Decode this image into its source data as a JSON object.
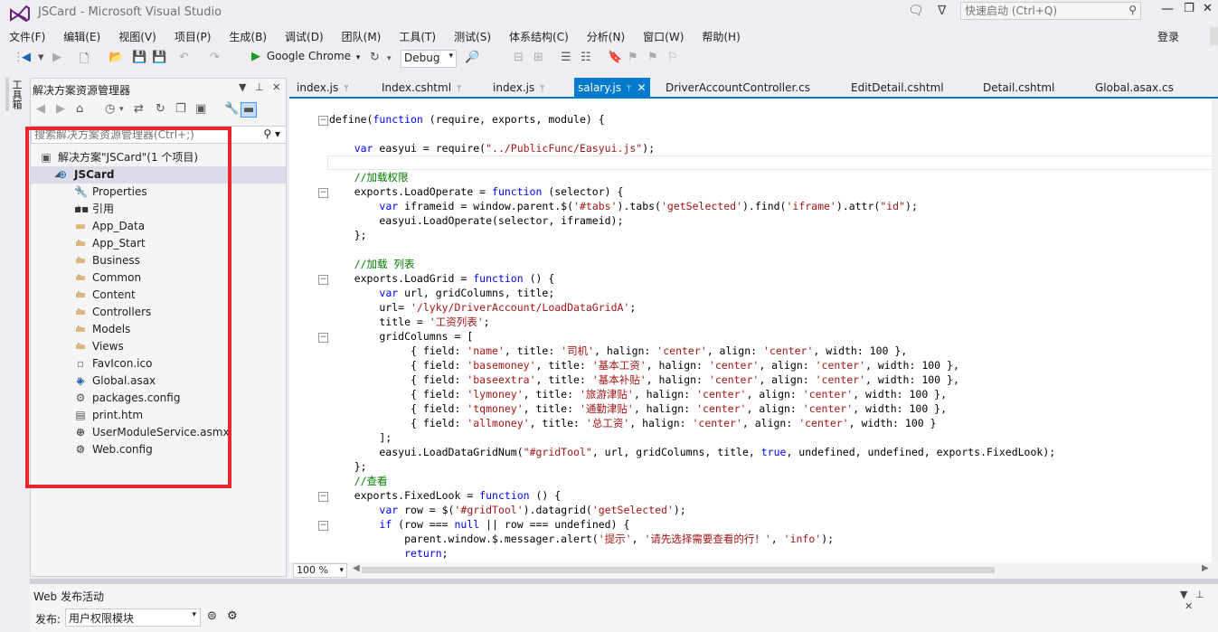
{
  "window": {
    "title": "JSCard - Microsoft Visual Studio",
    "quick_launch_placeholder": "快速启动 (Ctrl+Q)",
    "sign_in": "登录"
  },
  "menu": [
    "文件(F)",
    "编辑(E)",
    "视图(V)",
    "项目(P)",
    "生成(B)",
    "调试(D)",
    "团队(M)",
    "工具(T)",
    "测试(S)",
    "体系结构(C)",
    "分析(N)",
    "窗口(W)",
    "帮助(H)"
  ],
  "toolbar": {
    "browser": "Google Chrome",
    "config": "Debug"
  },
  "toolbox": {
    "label": "工具箱"
  },
  "solution_explorer": {
    "title": "解决方案资源管理器",
    "search_placeholder": "搜索解决方案资源管理器(Ctrl+;)",
    "tree": [
      {
        "label": "解决方案\"JSCard\"(1 个项目)",
        "icon": "solution-icon",
        "depth": 0,
        "expander": "none"
      },
      {
        "label": "JSCard",
        "icon": "web-project-icon",
        "depth": 1,
        "expander": "expanded",
        "selected": true,
        "bold": true
      },
      {
        "label": "Properties",
        "icon": "wrench-icon",
        "depth": 2,
        "expander": "collapsed"
      },
      {
        "label": "引用",
        "icon": "references-icon",
        "depth": 2,
        "expander": "collapsed"
      },
      {
        "label": "App_Data",
        "icon": "folder-icon",
        "depth": 2,
        "expander": "none"
      },
      {
        "label": "App_Start",
        "icon": "folder-icon",
        "depth": 2,
        "expander": "collapsed"
      },
      {
        "label": "Business",
        "icon": "folder-icon",
        "depth": 2,
        "expander": "collapsed"
      },
      {
        "label": "Common",
        "icon": "folder-icon",
        "depth": 2,
        "expander": "collapsed"
      },
      {
        "label": "Content",
        "icon": "folder-icon",
        "depth": 2,
        "expander": "collapsed"
      },
      {
        "label": "Controllers",
        "icon": "folder-icon",
        "depth": 2,
        "expander": "collapsed"
      },
      {
        "label": "Models",
        "icon": "folder-icon",
        "depth": 2,
        "expander": "collapsed"
      },
      {
        "label": "Views",
        "icon": "folder-icon",
        "depth": 2,
        "expander": "collapsed"
      },
      {
        "label": "FavIcon.ico",
        "icon": "image-file-icon",
        "depth": 2,
        "expander": "none"
      },
      {
        "label": "Global.asax",
        "icon": "asax-file-icon",
        "depth": 2,
        "expander": "collapsed"
      },
      {
        "label": "packages.config",
        "icon": "config-file-icon",
        "depth": 2,
        "expander": "none"
      },
      {
        "label": "print.htm",
        "icon": "html-file-icon",
        "depth": 2,
        "expander": "none"
      },
      {
        "label": "UserModuleService.asmx",
        "icon": "web-service-icon",
        "depth": 2,
        "expander": "collapsed"
      },
      {
        "label": "Web.config",
        "icon": "config-file-icon",
        "depth": 2,
        "expander": "collapsed"
      }
    ]
  },
  "tabs": [
    {
      "label": "index.js",
      "pinned": true
    },
    {
      "label": "Index.cshtml",
      "pinned": true
    },
    {
      "label": "index.js",
      "pinned": true
    },
    {
      "label": "salary.js",
      "pinned": true,
      "active": true
    },
    {
      "label": "DriverAccountController.cs"
    },
    {
      "label": "EditDetail.cshtml"
    },
    {
      "label": "Detail.cshtml"
    },
    {
      "label": "Global.asax.cs"
    }
  ],
  "editor": {
    "zoom": "100 %",
    "lines": [
      [
        [
          "define(",
          ""
        ],
        [
          "function",
          "kw"
        ],
        [
          " (require, exports, module) {",
          ""
        ]
      ],
      [
        [
          "",
          ""
        ]
      ],
      [
        [
          "    ",
          ""
        ],
        [
          "var",
          "kw"
        ],
        [
          " easyui = require(",
          ""
        ],
        [
          "\"../PublicFunc/Easyui.js\"",
          "str"
        ],
        [
          ");",
          ""
        ]
      ],
      [
        [
          "",
          ""
        ]
      ],
      [
        [
          "    ",
          ""
        ],
        [
          "//加载权限",
          "cm"
        ]
      ],
      [
        [
          "    exports.LoadOperate = ",
          ""
        ],
        [
          "function",
          "kw"
        ],
        [
          " (selector) {",
          ""
        ]
      ],
      [
        [
          "        ",
          ""
        ],
        [
          "var",
          "kw"
        ],
        [
          " iframeid = window.parent.$(",
          ""
        ],
        [
          "'#tabs'",
          "str"
        ],
        [
          ").tabs(",
          ""
        ],
        [
          "'getSelected'",
          "str"
        ],
        [
          ").find(",
          ""
        ],
        [
          "'iframe'",
          "str"
        ],
        [
          ").attr(",
          ""
        ],
        [
          "\"id\"",
          "str"
        ],
        [
          ");",
          ""
        ]
      ],
      [
        [
          "        easyui.LoadOperate(selector, iframeid);",
          ""
        ]
      ],
      [
        [
          "    };",
          ""
        ]
      ],
      [
        [
          "",
          ""
        ]
      ],
      [
        [
          "    ",
          ""
        ],
        [
          "//加载 列表",
          "cm"
        ]
      ],
      [
        [
          "    exports.LoadGrid = ",
          ""
        ],
        [
          "function",
          "kw"
        ],
        [
          " () {",
          ""
        ]
      ],
      [
        [
          "        ",
          ""
        ],
        [
          "var",
          "kw"
        ],
        [
          " url, gridColumns, title;",
          ""
        ]
      ],
      [
        [
          "        url= ",
          ""
        ],
        [
          "'/lyky/DriverAccount/LoadDataGridA'",
          "str"
        ],
        [
          ";",
          ""
        ]
      ],
      [
        [
          "        title = ",
          ""
        ],
        [
          "'工资列表'",
          "str"
        ],
        [
          ";",
          ""
        ]
      ],
      [
        [
          "        gridColumns = [",
          ""
        ]
      ],
      [
        [
          "             { field: ",
          ""
        ],
        [
          "'name'",
          "str"
        ],
        [
          ", title: ",
          ""
        ],
        [
          "'司机'",
          "str"
        ],
        [
          ", halign: ",
          ""
        ],
        [
          "'center'",
          "str"
        ],
        [
          ", align: ",
          ""
        ],
        [
          "'center'",
          "str"
        ],
        [
          ", width: 100 },",
          ""
        ]
      ],
      [
        [
          "             { field: ",
          ""
        ],
        [
          "'basemoney'",
          "str"
        ],
        [
          ", title: ",
          ""
        ],
        [
          "'基本工资'",
          "str"
        ],
        [
          ", halign: ",
          ""
        ],
        [
          "'center'",
          "str"
        ],
        [
          ", align: ",
          ""
        ],
        [
          "'center'",
          "str"
        ],
        [
          ", width: 100 },",
          ""
        ]
      ],
      [
        [
          "             { field: ",
          ""
        ],
        [
          "'baseextra'",
          "str"
        ],
        [
          ", title: ",
          ""
        ],
        [
          "'基本补贴'",
          "str"
        ],
        [
          ", halign: ",
          ""
        ],
        [
          "'center'",
          "str"
        ],
        [
          ", align: ",
          ""
        ],
        [
          "'center'",
          "str"
        ],
        [
          ", width: 100 },",
          ""
        ]
      ],
      [
        [
          "             { field: ",
          ""
        ],
        [
          "'lymoney'",
          "str"
        ],
        [
          ", title: ",
          ""
        ],
        [
          "'旅游津贴'",
          "str"
        ],
        [
          ", halign: ",
          ""
        ],
        [
          "'center'",
          "str"
        ],
        [
          ", align: ",
          ""
        ],
        [
          "'center'",
          "str"
        ],
        [
          ", width: 100 },",
          ""
        ]
      ],
      [
        [
          "             { field: ",
          ""
        ],
        [
          "'tqmoney'",
          "str"
        ],
        [
          ", title: ",
          ""
        ],
        [
          "'通勤津贴'",
          "str"
        ],
        [
          ", halign: ",
          ""
        ],
        [
          "'center'",
          "str"
        ],
        [
          ", align: ",
          ""
        ],
        [
          "'center'",
          "str"
        ],
        [
          ", width: 100 },",
          ""
        ]
      ],
      [
        [
          "             { field: ",
          ""
        ],
        [
          "'allmoney'",
          "str"
        ],
        [
          ", title: ",
          ""
        ],
        [
          "'总工资'",
          "str"
        ],
        [
          ", halign: ",
          ""
        ],
        [
          "'center'",
          "str"
        ],
        [
          ", align: ",
          ""
        ],
        [
          "'center'",
          "str"
        ],
        [
          ", width: 100 }",
          ""
        ]
      ],
      [
        [
          "        ];",
          ""
        ]
      ],
      [
        [
          "        easyui.LoadDataGridNum(",
          ""
        ],
        [
          "\"#gridTool\"",
          "str"
        ],
        [
          ", url, gridColumns, title, ",
          ""
        ],
        [
          "true",
          "kw"
        ],
        [
          ", undefined, undefined, exports.FixedLook);",
          ""
        ]
      ],
      [
        [
          "    };",
          ""
        ]
      ],
      [
        [
          "    ",
          ""
        ],
        [
          "//查看",
          "cm"
        ]
      ],
      [
        [
          "    exports.FixedLook = ",
          ""
        ],
        [
          "function",
          "kw"
        ],
        [
          " () {",
          ""
        ]
      ],
      [
        [
          "        ",
          ""
        ],
        [
          "var",
          "kw"
        ],
        [
          " row = $(",
          ""
        ],
        [
          "'#gridTool'",
          "str"
        ],
        [
          ").datagrid(",
          ""
        ],
        [
          "'getSelected'",
          "str"
        ],
        [
          ");",
          ""
        ]
      ],
      [
        [
          "        ",
          ""
        ],
        [
          "if",
          "kw"
        ],
        [
          " (row === ",
          ""
        ],
        [
          "null",
          "kw"
        ],
        [
          " || row === undefined) {",
          ""
        ]
      ],
      [
        [
          "            parent.window.$.messager.alert(",
          ""
        ],
        [
          "'提示'",
          "str"
        ],
        [
          ", ",
          ""
        ],
        [
          "'请先选择需要查看的行！'",
          "str"
        ],
        [
          ", ",
          ""
        ],
        [
          "'info'",
          "str"
        ],
        [
          ");",
          ""
        ]
      ],
      [
        [
          "            ",
          ""
        ],
        [
          "return",
          "kw"
        ],
        [
          ";",
          ""
        ]
      ]
    ]
  },
  "bottom_panel": {
    "title": "Web 发布活动",
    "publish_label": "发布:",
    "publish_value": "用户权限模块"
  }
}
